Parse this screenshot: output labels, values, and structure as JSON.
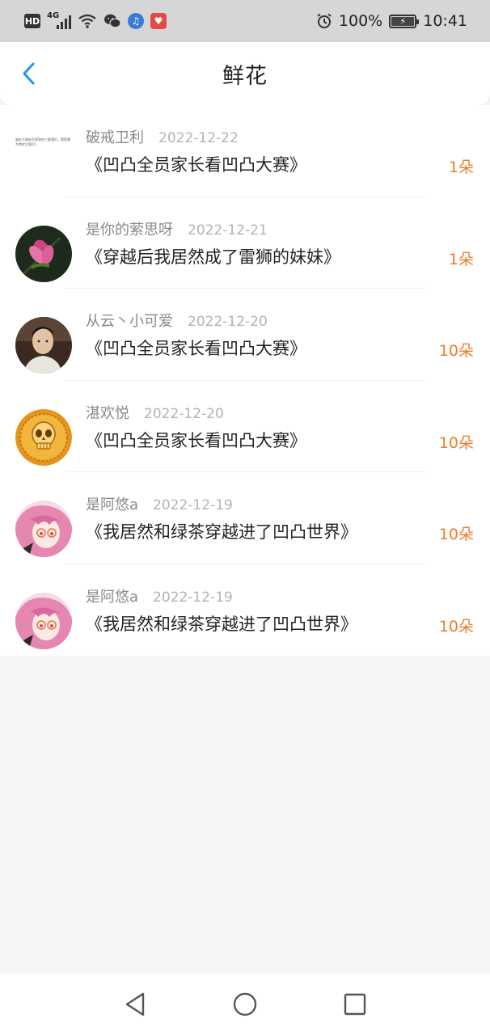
{
  "status_bar": {
    "hd": "HD",
    "network": "4G",
    "battery": "100%",
    "time": "10:41"
  },
  "header": {
    "title": "鲜花"
  },
  "records": [
    {
      "name": "破戒卫利",
      "date": "2022-12-22",
      "book": "《凹凸全员家长看凹凸大赛》",
      "count": "1朵",
      "avatar": "text-note-avatar",
      "avatar_text": "留在大佬给大家到的三星我们，就是想为特学大家们！"
    },
    {
      "name": "是你的萦思呀",
      "date": "2022-12-21",
      "book": "《穿越后我居然成了雷狮的妹妹》",
      "count": "1朵",
      "avatar": "magnolia-flower-avatar"
    },
    {
      "name": "从云丶小可爱",
      "date": "2022-12-20",
      "book": "《凹凸全员家长看凹凸大赛》",
      "count": "10朵",
      "avatar": "boy-portrait-avatar"
    },
    {
      "name": "湛欢悦",
      "date": "2022-12-20",
      "book": "《凹凸全员家长看凹凸大赛》",
      "count": "10朵",
      "avatar": "golden-skull-avatar"
    },
    {
      "name": "是阿悠a",
      "date": "2022-12-19",
      "book": "《我居然和绿茶穿越进了凹凸世界》",
      "count": "10朵",
      "avatar": "pink-hair-anime-avatar"
    },
    {
      "name": "是阿悠a",
      "date": "2022-12-19",
      "book": "《我居然和绿茶穿越进了凹凸世界》",
      "count": "10朵",
      "avatar": "pink-hair-anime-avatar"
    }
  ],
  "colors": {
    "accent_blue": "#2196f3",
    "count_orange": "#f07b2a",
    "background": "#f7f6f7"
  }
}
